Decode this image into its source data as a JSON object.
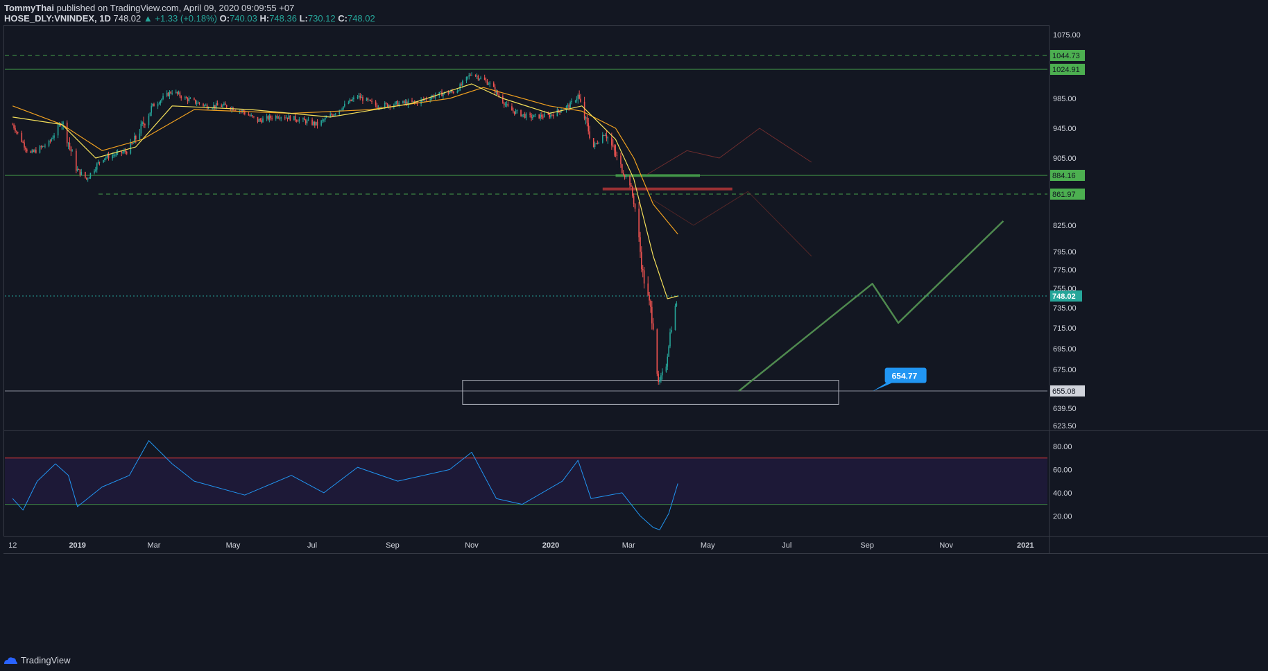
{
  "header": {
    "author": "TommyThai",
    "published": "published on TradingView.com, April 09, 2020 09:09:55 +07",
    "symbol": "HOSE_DLY:VNINDEX, 1D",
    "last": "748.02",
    "change": "▲ +1.33 (+0.18%)",
    "o_label": "O:",
    "o": "740.03",
    "h_label": "H:",
    "h": "748.36",
    "l_label": "L:",
    "l": "730.12",
    "c_label": "C:",
    "c": "748.02"
  },
  "footer": {
    "brand": "TradingView"
  },
  "colors": {
    "bg": "#131722",
    "up": "#26a69a",
    "down": "#ef5350",
    "ma_fast": "#f5e05a",
    "ma_slow": "#f0a020",
    "rsi": "#2196f3",
    "rsi_band": "#1f1a3a",
    "level_green": "#4caf50",
    "callout": "#2196f3"
  },
  "chart_data": [
    {
      "type": "line",
      "title": "",
      "series_kind": "candlestick",
      "x_ticks": [
        "12",
        "2019",
        "Mar",
        "May",
        "Jul",
        "Sep",
        "Nov",
        "2020",
        "Mar",
        "May",
        "Jul",
        "Sep",
        "Nov",
        "2021"
      ],
      "y_ticks": [
        "1075.00",
        "985.00",
        "945.00",
        "905.00",
        "825.00",
        "795.00",
        "775.00",
        "755.00",
        "735.00",
        "715.00",
        "695.00",
        "675.00",
        "639.50",
        "623.50"
      ],
      "horizontal_levels": [
        {
          "value": 1044.73,
          "label": "1044.73",
          "style": "dashed"
        },
        {
          "value": 1024.91,
          "label": "1024.91",
          "style": "solid"
        },
        {
          "value": 884.16,
          "label": "884.16",
          "style": "solid"
        },
        {
          "value": 861.97,
          "label": "861.97",
          "style": "dashed"
        },
        {
          "value": 655.08,
          "label": "655.08",
          "style": "solid"
        }
      ],
      "last_price": {
        "value": 748.02,
        "label": "748.02"
      },
      "annotation": {
        "label": "654.77",
        "value": 654.77
      },
      "close_path": [
        {
          "x": "2018-11-12",
          "y": 950
        },
        {
          "x": "2018-11-25",
          "y": 910
        },
        {
          "x": "2018-12-10",
          "y": 925
        },
        {
          "x": "2018-12-20",
          "y": 955
        },
        {
          "x": "2018-12-31",
          "y": 892
        },
        {
          "x": "2019-01-08",
          "y": 880
        },
        {
          "x": "2019-01-20",
          "y": 905
        },
        {
          "x": "2019-02-10",
          "y": 915
        },
        {
          "x": "2019-02-28",
          "y": 975
        },
        {
          "x": "2019-03-15",
          "y": 995
        },
        {
          "x": "2019-03-25",
          "y": 985
        },
        {
          "x": "2019-04-10",
          "y": 975
        },
        {
          "x": "2019-04-25",
          "y": 975
        },
        {
          "x": "2019-05-08",
          "y": 968
        },
        {
          "x": "2019-05-20",
          "y": 955
        },
        {
          "x": "2019-06-05",
          "y": 962
        },
        {
          "x": "2019-06-20",
          "y": 957
        },
        {
          "x": "2019-07-05",
          "y": 950
        },
        {
          "x": "2019-07-20",
          "y": 968
        },
        {
          "x": "2019-08-05",
          "y": 988
        },
        {
          "x": "2019-08-20",
          "y": 975
        },
        {
          "x": "2019-09-05",
          "y": 978
        },
        {
          "x": "2019-09-20",
          "y": 980
        },
        {
          "x": "2019-10-05",
          "y": 990
        },
        {
          "x": "2019-10-20",
          "y": 995
        },
        {
          "x": "2019-11-01",
          "y": 1020
        },
        {
          "x": "2019-11-15",
          "y": 1005
        },
        {
          "x": "2019-11-30",
          "y": 970
        },
        {
          "x": "2019-12-15",
          "y": 960
        },
        {
          "x": "2019-12-31",
          "y": 962
        },
        {
          "x": "2020-01-15",
          "y": 975
        },
        {
          "x": "2020-01-22",
          "y": 988
        },
        {
          "x": "2020-02-03",
          "y": 920
        },
        {
          "x": "2020-02-12",
          "y": 940
        },
        {
          "x": "2020-02-25",
          "y": 890
        },
        {
          "x": "2020-03-02",
          "y": 875
        },
        {
          "x": "2020-03-06",
          "y": 845
        },
        {
          "x": "2020-03-12",
          "y": 770
        },
        {
          "x": "2020-03-20",
          "y": 720
        },
        {
          "x": "2020-03-24",
          "y": 660
        },
        {
          "x": "2020-03-30",
          "y": 680
        },
        {
          "x": "2020-04-02",
          "y": 710
        },
        {
          "x": "2020-04-08",
          "y": 748
        }
      ],
      "ma_fast": [
        {
          "x": "2018-11-12",
          "y": 960
        },
        {
          "x": "2018-12-20",
          "y": 950
        },
        {
          "x": "2019-01-15",
          "y": 905
        },
        {
          "x": "2019-02-15",
          "y": 920
        },
        {
          "x": "2019-03-15",
          "y": 975
        },
        {
          "x": "2019-05-15",
          "y": 970
        },
        {
          "x": "2019-07-15",
          "y": 960
        },
        {
          "x": "2019-09-15",
          "y": 978
        },
        {
          "x": "2019-11-01",
          "y": 1005
        },
        {
          "x": "2019-11-25",
          "y": 985
        },
        {
          "x": "2019-12-31",
          "y": 965
        },
        {
          "x": "2020-01-25",
          "y": 975
        },
        {
          "x": "2020-02-20",
          "y": 930
        },
        {
          "x": "2020-03-05",
          "y": 880
        },
        {
          "x": "2020-03-20",
          "y": 790
        },
        {
          "x": "2020-03-31",
          "y": 745
        },
        {
          "x": "2020-04-08",
          "y": 748
        }
      ],
      "ma_slow": [
        {
          "x": "2018-11-12",
          "y": 975
        },
        {
          "x": "2018-12-20",
          "y": 950
        },
        {
          "x": "2019-01-20",
          "y": 915
        },
        {
          "x": "2019-02-20",
          "y": 930
        },
        {
          "x": "2019-04-01",
          "y": 970
        },
        {
          "x": "2019-06-15",
          "y": 965
        },
        {
          "x": "2019-08-15",
          "y": 970
        },
        {
          "x": "2019-10-15",
          "y": 985
        },
        {
          "x": "2019-11-10",
          "y": 1000
        },
        {
          "x": "2019-12-31",
          "y": 975
        },
        {
          "x": "2020-01-25",
          "y": 968
        },
        {
          "x": "2020-02-20",
          "y": 945
        },
        {
          "x": "2020-03-05",
          "y": 905
        },
        {
          "x": "2020-03-20",
          "y": 850
        },
        {
          "x": "2020-04-08",
          "y": 815
        }
      ],
      "projections": [
        {
          "name": "",
          "points": [
            {
              "x": "2020-03-15",
              "y": 885
            },
            {
              "x": "2020-04-15",
              "y": 915
            },
            {
              "x": "2020-05-10",
              "y": 905
            },
            {
              "x": "2020-06-10",
              "y": 945
            },
            {
              "x": "2020-07-20",
              "y": 900
            }
          ]
        },
        {
          "name": "",
          "points": [
            {
              "x": "2020-03-20",
              "y": 855
            },
            {
              "x": "2020-04-20",
              "y": 825
            },
            {
              "x": "2020-06-01",
              "y": 865
            },
            {
              "x": "2020-07-20",
              "y": 790
            }
          ]
        },
        {
          "name": "",
          "points": [
            {
              "x": "2020-05-25",
              "y": 655
            },
            {
              "x": "2020-09-05",
              "y": 760
            },
            {
              "x": "2020-09-25",
              "y": 720
            },
            {
              "x": "2020-12-15",
              "y": 830
            }
          ]
        }
      ],
      "zones": [
        {
          "x1": "2019-10-25",
          "x2": "2020-08-10",
          "y1": 643,
          "y2": 665
        }
      ]
    },
    {
      "type": "line",
      "title": "",
      "series_kind": "RSI",
      "y_ticks": [
        "80.00",
        "60.00",
        "40.00",
        "20.00"
      ],
      "overbought": 70,
      "oversold": 30,
      "points": [
        {
          "x": "2018-11-12",
          "y": 35
        },
        {
          "x": "2018-11-20",
          "y": 25
        },
        {
          "x": "2018-12-01",
          "y": 50
        },
        {
          "x": "2018-12-15",
          "y": 65
        },
        {
          "x": "2018-12-25",
          "y": 55
        },
        {
          "x": "2019-01-01",
          "y": 28
        },
        {
          "x": "2019-01-20",
          "y": 45
        },
        {
          "x": "2019-02-10",
          "y": 55
        },
        {
          "x": "2019-02-25",
          "y": 85
        },
        {
          "x": "2019-03-15",
          "y": 65
        },
        {
          "x": "2019-04-01",
          "y": 50
        },
        {
          "x": "2019-05-10",
          "y": 38
        },
        {
          "x": "2019-06-15",
          "y": 55
        },
        {
          "x": "2019-07-10",
          "y": 40
        },
        {
          "x": "2019-08-05",
          "y": 62
        },
        {
          "x": "2019-09-05",
          "y": 50
        },
        {
          "x": "2019-10-15",
          "y": 60
        },
        {
          "x": "2019-11-01",
          "y": 75
        },
        {
          "x": "2019-11-20",
          "y": 35
        },
        {
          "x": "2019-12-10",
          "y": 30
        },
        {
          "x": "2020-01-10",
          "y": 50
        },
        {
          "x": "2020-01-22",
          "y": 68
        },
        {
          "x": "2020-02-01",
          "y": 35
        },
        {
          "x": "2020-02-25",
          "y": 40
        },
        {
          "x": "2020-03-10",
          "y": 20
        },
        {
          "x": "2020-03-20",
          "y": 10
        },
        {
          "x": "2020-03-25",
          "y": 8
        },
        {
          "x": "2020-04-01",
          "y": 22
        },
        {
          "x": "2020-04-08",
          "y": 48
        }
      ]
    }
  ]
}
